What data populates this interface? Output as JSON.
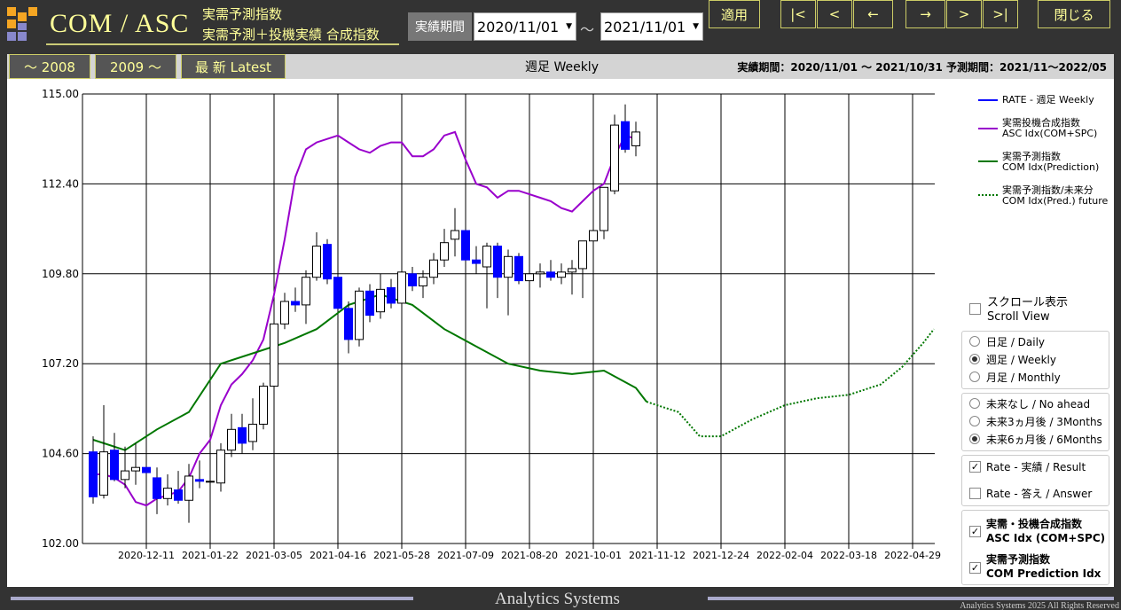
{
  "header": {
    "title": "COM / ASC",
    "subtitle1": "実需予測指数",
    "subtitle2": "実需予測＋投機実績 合成指数",
    "period_label": "実績期間",
    "date_from": "2020/11/01",
    "date_to": "2021/11/01",
    "tilde": "～",
    "apply": "適用",
    "nav_first": "|<",
    "nav_prev": "<",
    "nav_back": "←",
    "nav_fwd": "→",
    "nav_next": ">",
    "nav_last": ">|",
    "close": "閉じる"
  },
  "range_buttons": {
    "r1": "～ 2008",
    "r2": "2009 ～",
    "r3": "最 新  Latest"
  },
  "chart_title": "週足 Weekly",
  "period_info": "実績期間：2020/11/01 ～ 2021/10/31  予測期間：2021/11～2022/05",
  "legend": {
    "rate": "RATE - 週足 Weekly",
    "asc_1": "実需投機合成指数",
    "asc_2": "ASC Idx(COM+SPC)",
    "com_1": "実需予測指数",
    "com_2": "COM Idx(Prediction)",
    "fut_1": "実需予測指数/未来分",
    "fut_2": "COM Idx(Pred.) future"
  },
  "controls": {
    "scroll_1": "スクロール表示",
    "scroll_2": "Scroll View",
    "daily": "日足 / Daily",
    "weekly": "週足 / Weekly",
    "monthly": "月足 / Monthly",
    "no_ahead": "未来なし / No ahead",
    "m3": "未来3ヵ月後 / 3Months",
    "m6": "未来6ヵ月後 / 6Months",
    "rate_result": "Rate - 実績 / Result",
    "rate_answer": "Rate - 答え / Answer",
    "asc_cb_1": "実需・投機合成指数",
    "asc_cb_2": "ASC Idx (COM+SPC)",
    "com_cb_1": "実需予測指数",
    "com_cb_2": "COM Prediction Idx",
    "selected_period": "weekly",
    "selected_ahead": "6months"
  },
  "footer": {
    "title": "Analytics Systems",
    "copyright": "Analytics Systems 2025 All Rights Reserved"
  },
  "colors": {
    "rate": "#0000ff",
    "asc": "#9900cc",
    "com": "#007700",
    "future": "#007700"
  },
  "chart_data": {
    "type": "line",
    "ylim": [
      102.0,
      115.0
    ],
    "yticks": [
      "115.00",
      "112.40",
      "109.80",
      "107.20",
      "104.60",
      "102.00"
    ],
    "xticks": [
      "2020-12-11",
      "2021-01-22",
      "2021-03-05",
      "2021-04-16",
      "2021-05-28",
      "2021-07-09",
      "2021-08-20",
      "2021-10-01",
      "2021-11-12",
      "2021-12-24",
      "2022-02-04",
      "2022-03-18",
      "2022-04-29"
    ],
    "candles": [
      {
        "date": "2020-11-06",
        "o": 104.65,
        "h": 105.1,
        "l": 103.15,
        "c": 103.35
      },
      {
        "date": "2020-11-13",
        "o": 103.4,
        "h": 106.0,
        "l": 103.3,
        "c": 104.65
      },
      {
        "date": "2020-11-20",
        "o": 104.7,
        "h": 105.2,
        "l": 103.8,
        "c": 103.85
      },
      {
        "date": "2020-11-27",
        "o": 103.85,
        "h": 104.8,
        "l": 103.6,
        "c": 104.1
      },
      {
        "date": "2020-12-04",
        "o": 104.1,
        "h": 104.9,
        "l": 103.7,
        "c": 104.2
      },
      {
        "date": "2020-12-11",
        "o": 104.2,
        "h": 104.7,
        "l": 103.9,
        "c": 104.05
      },
      {
        "date": "2020-12-18",
        "o": 103.9,
        "h": 104.2,
        "l": 102.85,
        "c": 103.3
      },
      {
        "date": "2020-12-25",
        "o": 103.3,
        "h": 104.0,
        "l": 103.1,
        "c": 103.6
      },
      {
        "date": "2021-01-01",
        "o": 103.55,
        "h": 104.1,
        "l": 103.15,
        "c": 103.25
      },
      {
        "date": "2021-01-08",
        "o": 103.25,
        "h": 104.3,
        "l": 102.6,
        "c": 103.95
      },
      {
        "date": "2021-01-15",
        "o": 103.85,
        "h": 104.4,
        "l": 103.6,
        "c": 103.8
      },
      {
        "date": "2021-01-22",
        "o": 103.8,
        "h": 104.0,
        "l": 103.5,
        "c": 103.8
      },
      {
        "date": "2021-01-29",
        "o": 103.75,
        "h": 104.9,
        "l": 103.5,
        "c": 104.7
      },
      {
        "date": "2021-02-05",
        "o": 104.7,
        "h": 105.75,
        "l": 104.5,
        "c": 105.3
      },
      {
        "date": "2021-02-12",
        "o": 105.35,
        "h": 105.75,
        "l": 104.6,
        "c": 104.9
      },
      {
        "date": "2021-02-19",
        "o": 104.95,
        "h": 106.2,
        "l": 104.7,
        "c": 105.45
      },
      {
        "date": "2021-02-26",
        "o": 105.45,
        "h": 106.65,
        "l": 105.3,
        "c": 106.55
      },
      {
        "date": "2021-03-05",
        "o": 106.55,
        "h": 108.6,
        "l": 106.3,
        "c": 108.35
      },
      {
        "date": "2021-03-12",
        "o": 108.35,
        "h": 109.25,
        "l": 108.2,
        "c": 109.0
      },
      {
        "date": "2021-03-19",
        "o": 109.0,
        "h": 109.4,
        "l": 108.7,
        "c": 108.9
      },
      {
        "date": "2021-03-26",
        "o": 108.9,
        "h": 109.9,
        "l": 108.35,
        "c": 109.7
      },
      {
        "date": "2021-04-02",
        "o": 109.7,
        "h": 111.0,
        "l": 109.6,
        "c": 110.6
      },
      {
        "date": "2021-04-09",
        "o": 110.65,
        "h": 110.8,
        "l": 109.5,
        "c": 109.65
      },
      {
        "date": "2021-04-16",
        "o": 109.7,
        "h": 109.85,
        "l": 108.7,
        "c": 108.8
      },
      {
        "date": "2021-04-23",
        "o": 108.8,
        "h": 109.0,
        "l": 107.5,
        "c": 107.9
      },
      {
        "date": "2021-04-30",
        "o": 107.9,
        "h": 109.4,
        "l": 107.7,
        "c": 109.3
      },
      {
        "date": "2021-05-07",
        "o": 109.3,
        "h": 109.5,
        "l": 108.4,
        "c": 108.6
      },
      {
        "date": "2021-05-14",
        "o": 108.7,
        "h": 109.8,
        "l": 108.5,
        "c": 109.35
      },
      {
        "date": "2021-05-21",
        "o": 109.4,
        "h": 109.65,
        "l": 108.8,
        "c": 108.95
      },
      {
        "date": "2021-05-28",
        "o": 108.95,
        "h": 109.9,
        "l": 108.6,
        "c": 109.85
      },
      {
        "date": "2021-06-04",
        "o": 109.8,
        "h": 110.0,
        "l": 109.3,
        "c": 109.45
      },
      {
        "date": "2021-06-11",
        "o": 109.45,
        "h": 109.9,
        "l": 109.1,
        "c": 109.7
      },
      {
        "date": "2021-06-18",
        "o": 109.7,
        "h": 110.4,
        "l": 109.5,
        "c": 110.2
      },
      {
        "date": "2021-06-25",
        "o": 110.2,
        "h": 111.1,
        "l": 110.0,
        "c": 110.7
      },
      {
        "date": "2021-07-02",
        "o": 110.8,
        "h": 111.7,
        "l": 110.3,
        "c": 111.05
      },
      {
        "date": "2021-07-09",
        "o": 111.05,
        "h": 111.1,
        "l": 109.9,
        "c": 110.2
      },
      {
        "date": "2021-07-16",
        "o": 110.2,
        "h": 110.6,
        "l": 109.8,
        "c": 110.1
      },
      {
        "date": "2021-07-23",
        "o": 110.0,
        "h": 110.7,
        "l": 108.8,
        "c": 110.6
      },
      {
        "date": "2021-07-30",
        "o": 110.6,
        "h": 110.7,
        "l": 109.1,
        "c": 109.7
      },
      {
        "date": "2021-08-06",
        "o": 109.7,
        "h": 110.5,
        "l": 108.6,
        "c": 110.3
      },
      {
        "date": "2021-08-13",
        "o": 110.3,
        "h": 110.4,
        "l": 109.5,
        "c": 109.6
      },
      {
        "date": "2021-08-20",
        "o": 109.6,
        "h": 110.0,
        "l": 109.4,
        "c": 109.8
      },
      {
        "date": "2021-08-27",
        "o": 109.8,
        "h": 110.1,
        "l": 109.4,
        "c": 109.85
      },
      {
        "date": "2021-09-03",
        "o": 109.85,
        "h": 110.2,
        "l": 109.6,
        "c": 109.7
      },
      {
        "date": "2021-09-10",
        "o": 109.7,
        "h": 110.1,
        "l": 109.5,
        "c": 109.85
      },
      {
        "date": "2021-09-17",
        "o": 109.85,
        "h": 110.2,
        "l": 109.2,
        "c": 109.95
      },
      {
        "date": "2021-09-24",
        "o": 109.95,
        "h": 110.7,
        "l": 109.1,
        "c": 110.75
      },
      {
        "date": "2021-10-01",
        "o": 110.75,
        "h": 111.5,
        "l": 110.6,
        "c": 111.05
      },
      {
        "date": "2021-10-08",
        "o": 111.05,
        "h": 112.3,
        "l": 110.8,
        "c": 112.3
      },
      {
        "date": "2021-10-15",
        "o": 112.2,
        "h": 114.4,
        "l": 112.1,
        "c": 114.1
      },
      {
        "date": "2021-10-22",
        "o": 114.2,
        "h": 114.7,
        "l": 113.3,
        "c": 113.4
      },
      {
        "date": "2021-10-29",
        "o": 113.5,
        "h": 114.2,
        "l": 113.2,
        "c": 113.9
      }
    ],
    "series": [
      {
        "name": "実需投機合成指数 ASC Idx(COM+SPC)",
        "points": [
          [
            "2020-11-06",
            104.0
          ],
          [
            "2020-11-13",
            104.0
          ],
          [
            "2020-11-20",
            103.9
          ],
          [
            "2020-11-27",
            103.7
          ],
          [
            "2020-12-04",
            103.2
          ],
          [
            "2020-12-11",
            103.1
          ],
          [
            "2020-12-18",
            103.3
          ],
          [
            "2020-12-25",
            103.4
          ],
          [
            "2021-01-01",
            103.5
          ],
          [
            "2021-01-08",
            103.9
          ],
          [
            "2021-01-15",
            104.6
          ],
          [
            "2021-01-22",
            105.0
          ],
          [
            "2021-01-29",
            106.0
          ],
          [
            "2021-02-05",
            106.6
          ],
          [
            "2021-02-12",
            106.9
          ],
          [
            "2021-02-19",
            107.3
          ],
          [
            "2021-02-26",
            107.9
          ],
          [
            "2021-03-05",
            109.2
          ],
          [
            "2021-03-12",
            110.8
          ],
          [
            "2021-03-19",
            112.6
          ],
          [
            "2021-03-26",
            113.4
          ],
          [
            "2021-04-02",
            113.6
          ],
          [
            "2021-04-09",
            113.7
          ],
          [
            "2021-04-16",
            113.8
          ],
          [
            "2021-04-23",
            113.6
          ],
          [
            "2021-04-30",
            113.4
          ],
          [
            "2021-05-07",
            113.3
          ],
          [
            "2021-05-14",
            113.5
          ],
          [
            "2021-05-21",
            113.6
          ],
          [
            "2021-05-28",
            113.6
          ],
          [
            "2021-06-04",
            113.2
          ],
          [
            "2021-06-11",
            113.2
          ],
          [
            "2021-06-18",
            113.4
          ],
          [
            "2021-06-25",
            113.8
          ],
          [
            "2021-07-02",
            113.9
          ],
          [
            "2021-07-09",
            113.1
          ],
          [
            "2021-07-16",
            112.4
          ],
          [
            "2021-07-23",
            112.3
          ],
          [
            "2021-07-30",
            112.0
          ],
          [
            "2021-08-06",
            112.2
          ],
          [
            "2021-08-13",
            112.2
          ],
          [
            "2021-08-20",
            112.1
          ],
          [
            "2021-08-27",
            112.0
          ],
          [
            "2021-09-03",
            111.9
          ],
          [
            "2021-09-10",
            111.7
          ],
          [
            "2021-09-17",
            111.6
          ],
          [
            "2021-09-24",
            111.9
          ],
          [
            "2021-10-01",
            112.2
          ],
          [
            "2021-10-08",
            112.4
          ],
          [
            "2021-10-15",
            113.2
          ],
          [
            "2021-10-22",
            113.8
          ],
          [
            "2021-10-29",
            113.7
          ]
        ]
      },
      {
        "name": "実需予測指数 COM Idx(Prediction)",
        "points": [
          [
            "2020-11-06",
            105.0
          ],
          [
            "2020-11-27",
            104.7
          ],
          [
            "2020-12-18",
            105.3
          ],
          [
            "2021-01-08",
            105.8
          ],
          [
            "2021-01-29",
            107.2
          ],
          [
            "2021-02-19",
            107.5
          ],
          [
            "2021-03-12",
            107.8
          ],
          [
            "2021-04-02",
            108.2
          ],
          [
            "2021-04-23",
            108.9
          ],
          [
            "2021-05-14",
            109.2
          ],
          [
            "2021-06-04",
            108.9
          ],
          [
            "2021-06-25",
            108.2
          ],
          [
            "2021-07-16",
            107.7
          ],
          [
            "2021-08-06",
            107.2
          ],
          [
            "2021-08-27",
            107.0
          ],
          [
            "2021-09-17",
            106.9
          ],
          [
            "2021-10-08",
            107.0
          ],
          [
            "2021-10-29",
            106.5
          ],
          [
            "2021-11-05",
            106.1
          ]
        ]
      },
      {
        "name": "実需予測指数/未来分 COM Idx(Pred.) future",
        "points": [
          [
            "2021-11-05",
            106.1
          ],
          [
            "2021-11-26",
            105.8
          ],
          [
            "2021-12-10",
            105.1
          ],
          [
            "2021-12-24",
            105.1
          ],
          [
            "2022-01-14",
            105.6
          ],
          [
            "2022-02-04",
            106.0
          ],
          [
            "2022-02-25",
            106.2
          ],
          [
            "2022-03-18",
            106.3
          ],
          [
            "2022-04-08",
            106.6
          ],
          [
            "2022-04-22",
            107.1
          ],
          [
            "2022-05-06",
            107.8
          ],
          [
            "2022-05-13",
            108.2
          ]
        ]
      }
    ]
  }
}
